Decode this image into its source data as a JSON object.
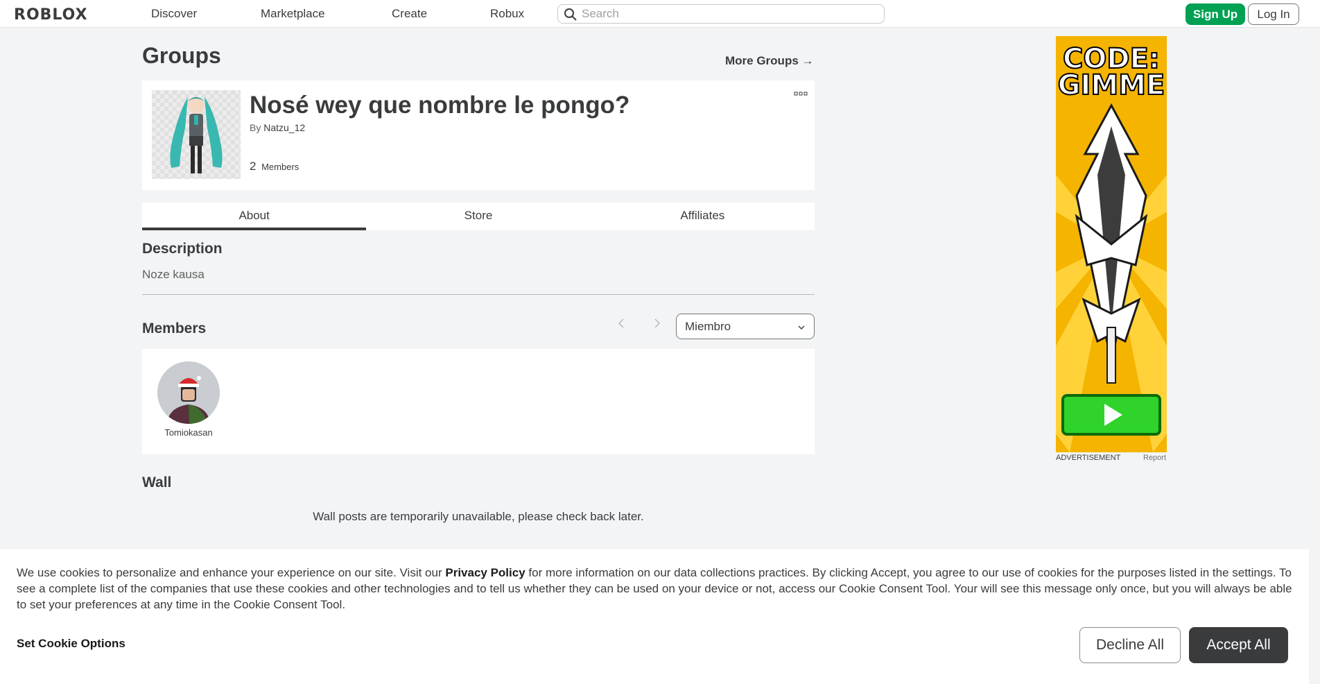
{
  "header": {
    "logo": "ROBLOX",
    "nav": [
      "Discover",
      "Marketplace",
      "Create",
      "Robux"
    ],
    "search_placeholder": "Search",
    "signup_label": "Sign Up",
    "login_label": "Log In"
  },
  "page": {
    "title": "Groups",
    "more_groups": "More Groups →"
  },
  "group": {
    "name": "Nosé wey que nombre le pongo?",
    "by_label": "By",
    "owner": "Natzu_12",
    "member_count": "2",
    "members_label": "Members"
  },
  "tabs": [
    "About",
    "Store",
    "Affiliates"
  ],
  "about": {
    "description_heading": "Description",
    "description": "Noze kausa",
    "members_heading": "Members",
    "role_selected": "Miembro",
    "members": [
      {
        "name": "Tomiokasan"
      }
    ],
    "wall_heading": "Wall",
    "wall_message": "Wall posts are temporarily unavailable, please check back later."
  },
  "ad": {
    "headline_1": "CODE:",
    "headline_2": "GIMME",
    "label": "ADVERTISEMENT",
    "report": "Report"
  },
  "cookie": {
    "text_before": "We use cookies to personalize and enhance your experience on our site. Visit our ",
    "privacy_link": "Privacy Policy",
    "text_after": " for more information on our data collections practices. By clicking Accept, you agree to our use of cookies for the purposes listed in the settings. To see a complete list of the companies that use these cookies and other technologies and to tell us whether they can be used on your device or not, access our Cookie Consent Tool. Your will see this message only once, but you will always be able to set your preferences at any time in the Cookie Consent Tool.",
    "options_label": "Set Cookie Options",
    "decline_label": "Decline All",
    "accept_label": "Accept All"
  },
  "colors": {
    "signup_green": "#00a153",
    "accept_dark": "#393b3d",
    "ad_yellow": "#f5b400",
    "play_green": "#2fd32a"
  }
}
